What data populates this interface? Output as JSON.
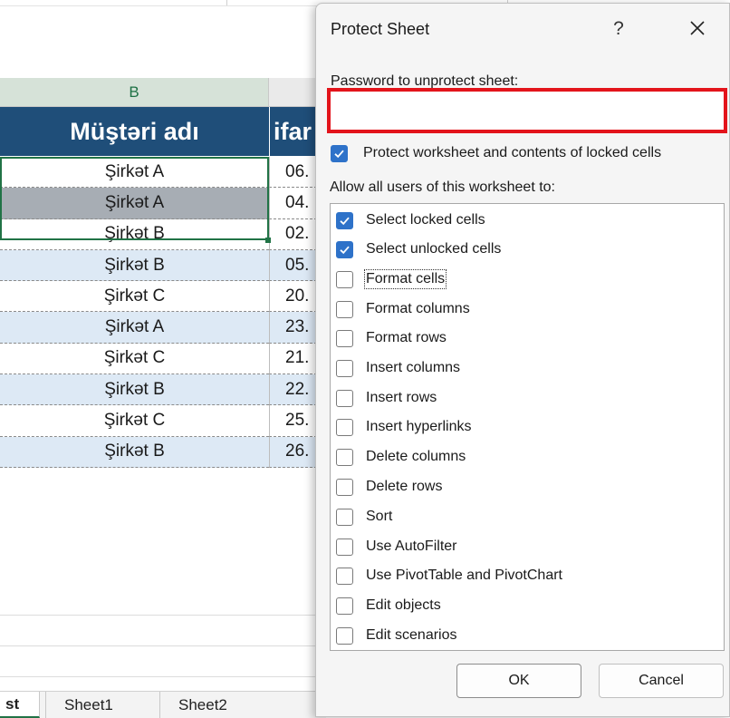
{
  "sheet": {
    "col_b_header": "B",
    "table_header_b": "Müştəri adı",
    "table_header_c": "ifar",
    "rows": [
      {
        "name": "Şirkət A",
        "date": "06."
      },
      {
        "name": "Şirkət A",
        "date": "04."
      },
      {
        "name": "Şirkət B",
        "date": "02."
      },
      {
        "name": "Şirkət B",
        "date": "05."
      },
      {
        "name": "Şirkət C",
        "date": "20."
      },
      {
        "name": "Şirkət A",
        "date": "23."
      },
      {
        "name": "Şirkət C",
        "date": "21."
      },
      {
        "name": "Şirkət B",
        "date": "22."
      },
      {
        "name": "Şirkət C",
        "date": "25."
      },
      {
        "name": "Şirkət B",
        "date": "26."
      }
    ],
    "tabs": [
      "st",
      "Sheet1",
      "Sheet2"
    ]
  },
  "dialog": {
    "title": "Protect Sheet",
    "help": "?",
    "close": "✕",
    "password_label": "Password to unprotect sheet:",
    "password_value": "",
    "protect_label": "Protect worksheet and contents of locked cells",
    "protect_checked": true,
    "allow_label": "Allow all users of this worksheet to:",
    "permissions": [
      {
        "label": "Select locked cells",
        "checked": true
      },
      {
        "label": "Select unlocked cells",
        "checked": true
      },
      {
        "label": "Format cells",
        "checked": false
      },
      {
        "label": "Format columns",
        "checked": false
      },
      {
        "label": "Format rows",
        "checked": false
      },
      {
        "label": "Insert columns",
        "checked": false
      },
      {
        "label": "Insert rows",
        "checked": false
      },
      {
        "label": "Insert hyperlinks",
        "checked": false
      },
      {
        "label": "Delete columns",
        "checked": false
      },
      {
        "label": "Delete rows",
        "checked": false
      },
      {
        "label": "Sort",
        "checked": false
      },
      {
        "label": "Use AutoFilter",
        "checked": false
      },
      {
        "label": "Use PivotTable and PivotChart",
        "checked": false
      },
      {
        "label": "Edit objects",
        "checked": false
      },
      {
        "label": "Edit scenarios",
        "checked": false
      }
    ],
    "ok_label": "OK",
    "cancel_label": "Cancel"
  },
  "colors": {
    "header_blue": "#1f4e79",
    "row_alt": "#dde9f5",
    "checkbox_blue": "#2e72c9",
    "highlight_red": "#e3141b"
  }
}
